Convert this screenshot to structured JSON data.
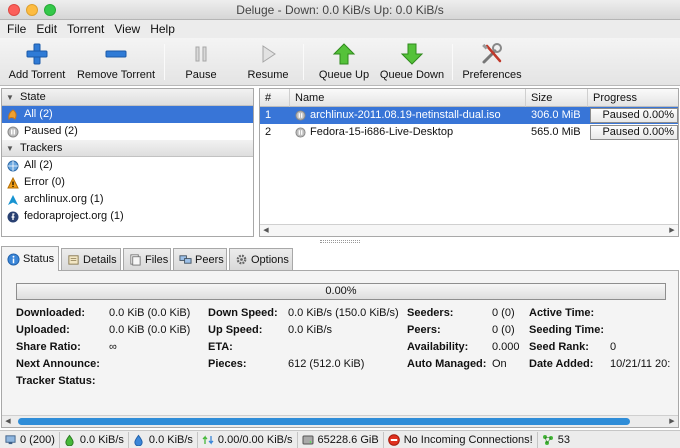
{
  "window": {
    "title": "Deluge - Down: 0.0 KiB/s Up: 0.0 KiB/s"
  },
  "menu": [
    "File",
    "Edit",
    "Torrent",
    "View",
    "Help"
  ],
  "toolbar": {
    "add_torrent": "Add Torrent",
    "remove_torrent": "Remove Torrent",
    "pause": "Pause",
    "resume": "Resume",
    "queue_up": "Queue Up",
    "queue_down": "Queue Down",
    "preferences": "Preferences"
  },
  "sidebar": {
    "state_header": "State",
    "state_items": [
      {
        "label": "All (2)",
        "icon": "all-icon"
      },
      {
        "label": "Paused (2)",
        "icon": "paused-icon"
      }
    ],
    "trackers_header": "Trackers",
    "tracker_items": [
      {
        "label": "All (2)",
        "icon": "globe-icon"
      },
      {
        "label": "Error (0)",
        "icon": "warning-icon"
      },
      {
        "label": "archlinux.org (1)",
        "icon": "archlinux-icon"
      },
      {
        "label": "fedoraproject.org (1)",
        "icon": "fedora-icon"
      }
    ]
  },
  "torrent_list": {
    "columns": {
      "num": "#",
      "name": "Name",
      "size": "Size",
      "progress": "Progress"
    },
    "rows": [
      {
        "num": "1",
        "name": "archlinux-2011.08.19-netinstall-dual.iso",
        "size": "306.0 MiB",
        "progress": "Paused 0.00%",
        "progress_fraction": 0.0
      },
      {
        "num": "2",
        "name": "Fedora-15-i686-Live-Desktop",
        "size": "565.0 MiB",
        "progress": "Paused 0.00%",
        "progress_fraction": 0.0
      }
    ]
  },
  "tabs": [
    "Status",
    "Details",
    "Files",
    "Peers",
    "Options"
  ],
  "status": {
    "progress": "0.00%",
    "progress_fraction": 0.0,
    "col1_labels": [
      "Downloaded:",
      "Uploaded:",
      "Share Ratio:",
      "Next Announce:",
      "Tracker Status:"
    ],
    "col1_values": [
      "0.0 KiB (0.0 KiB)",
      "0.0 KiB (0.0 KiB)",
      "∞",
      "",
      ""
    ],
    "col2_labels": [
      "Down Speed:",
      "Up Speed:",
      "ETA:",
      "Pieces:"
    ],
    "col2_values": [
      "0.0 KiB/s (150.0 KiB/s)",
      "0.0 KiB/s",
      "",
      "612 (512.0 KiB)"
    ],
    "col3_labels": [
      "Seeders:",
      "Peers:",
      "Availability:",
      "Auto Managed:"
    ],
    "col3_values": [
      "0 (0)",
      "0 (0)",
      "0.000",
      "On"
    ],
    "col4_labels": [
      "Active Time:",
      "Seeding Time:",
      "Seed Rank:",
      "Date Added:"
    ],
    "col4_values": [
      "",
      "",
      "0",
      "10/21/11 20:"
    ]
  },
  "statusbar": {
    "connections": "0 (200)",
    "down_speed": "0.0 KiB/s",
    "up_speed": "0.0 KiB/s",
    "protocol": "0.00/0.00 KiB/s",
    "free_space": "65228.6 GiB",
    "incoming": "No Incoming Connections!",
    "dht_nodes": "53"
  }
}
